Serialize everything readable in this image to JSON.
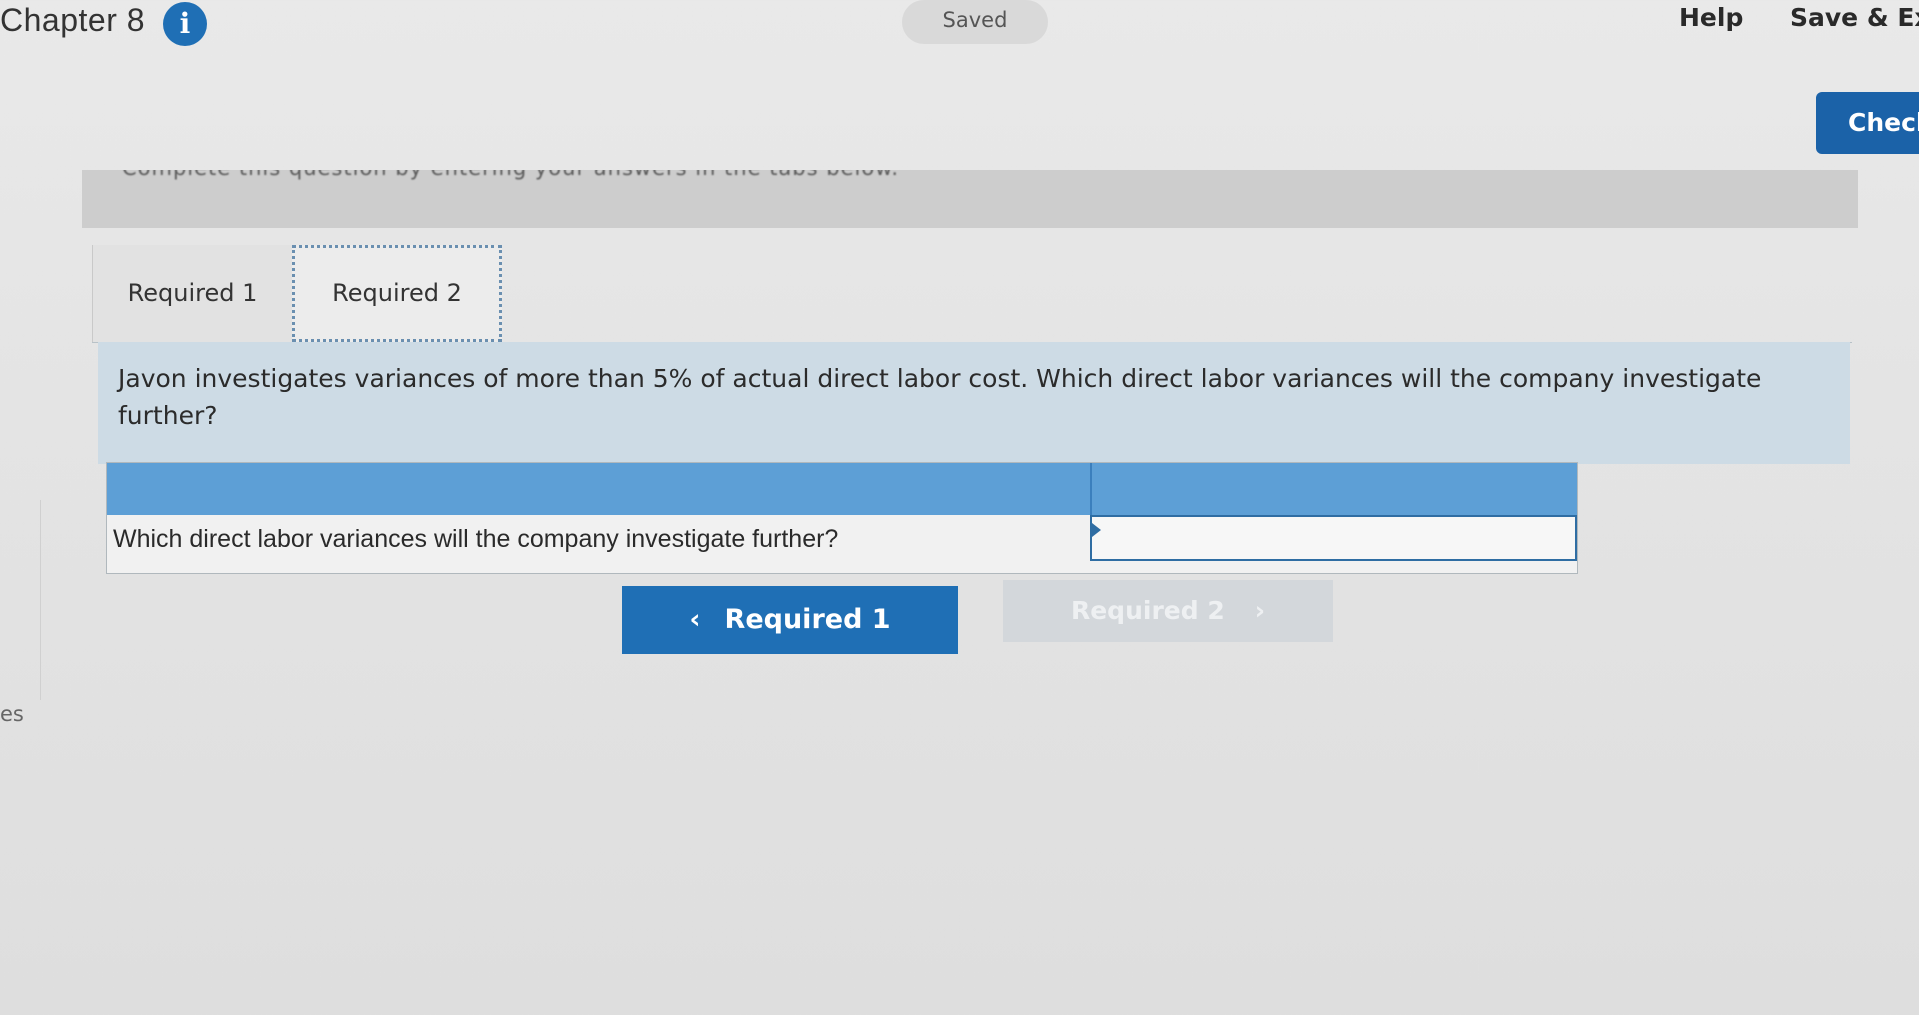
{
  "header": {
    "chapter_title": "Chapter 8",
    "info_icon": "i",
    "saved_status": "Saved",
    "help": "Help",
    "save_exit": "Save & Ex"
  },
  "check_button": "Checl",
  "instruction": "Complete this question by entering your answers in the tabs below.",
  "tabs": [
    {
      "label": "Required 1"
    },
    {
      "label": "Required 2"
    }
  ],
  "question": "Javon investigates variances of more than 5% of actual direct labor cost. Which direct labor variances will the company investigate further?",
  "answer_table": {
    "row_label": "Which direct labor variances will the company investigate further?",
    "selected_value": ""
  },
  "navigation": {
    "prev_label": "Required 1",
    "prev_icon": "‹",
    "next_label": "Required 2",
    "next_icon": "›"
  },
  "sidebar": {
    "fragment": "es"
  }
}
